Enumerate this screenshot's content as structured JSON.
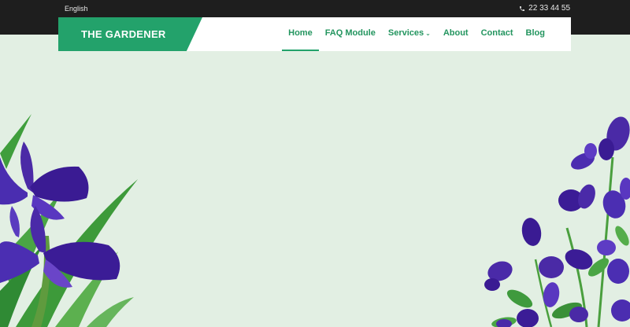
{
  "topbar": {
    "language": "English",
    "phone": "22 33 44 55",
    "background": "#1e1e1e"
  },
  "navbar": {
    "logo": "THE GARDENER",
    "brand_color": "#23a26b",
    "items": [
      {
        "label": "Home",
        "active": true
      },
      {
        "label": "FAQ Module"
      },
      {
        "label": "Services",
        "has_dropdown": true
      },
      {
        "label": "About"
      },
      {
        "label": "Contact"
      },
      {
        "label": "Blog"
      }
    ]
  },
  "hero": {
    "background": "#e2efe3",
    "decoration": [
      "iris-flowers",
      "lupine-flowers"
    ]
  }
}
